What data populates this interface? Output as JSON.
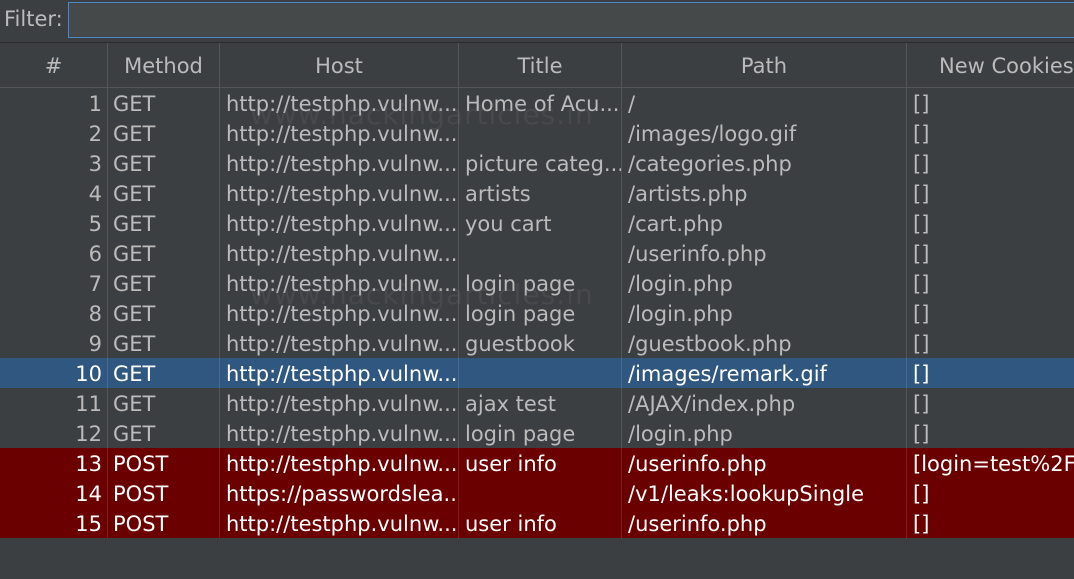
{
  "filter": {
    "label": "Filter:",
    "value": ""
  },
  "columns": [
    "#",
    "Method",
    "Host",
    "Title",
    "Path",
    "New Cookies"
  ],
  "rows": [
    {
      "num": "1",
      "method": "GET",
      "host": "http://testphp.vulnw...",
      "title": "Home of Acu...",
      "path": "/",
      "cookies": "[]",
      "state": "normal"
    },
    {
      "num": "2",
      "method": "GET",
      "host": "http://testphp.vulnw...",
      "title": "",
      "path": "/images/logo.gif",
      "cookies": "[]",
      "state": "normal"
    },
    {
      "num": "3",
      "method": "GET",
      "host": "http://testphp.vulnw...",
      "title": "picture categ...",
      "path": "/categories.php",
      "cookies": "[]",
      "state": "normal"
    },
    {
      "num": "4",
      "method": "GET",
      "host": "http://testphp.vulnw...",
      "title": "artists",
      "path": "/artists.php",
      "cookies": "[]",
      "state": "normal"
    },
    {
      "num": "5",
      "method": "GET",
      "host": "http://testphp.vulnw...",
      "title": "you cart",
      "path": "/cart.php",
      "cookies": "[]",
      "state": "normal"
    },
    {
      "num": "6",
      "method": "GET",
      "host": "http://testphp.vulnw...",
      "title": "",
      "path": "/userinfo.php",
      "cookies": "[]",
      "state": "normal"
    },
    {
      "num": "7",
      "method": "GET",
      "host": "http://testphp.vulnw...",
      "title": "login page",
      "path": "/login.php",
      "cookies": "[]",
      "state": "normal"
    },
    {
      "num": "8",
      "method": "GET",
      "host": "http://testphp.vulnw...",
      "title": "login page",
      "path": "/login.php",
      "cookies": "[]",
      "state": "normal"
    },
    {
      "num": "9",
      "method": "GET",
      "host": "http://testphp.vulnw...",
      "title": "guestbook",
      "path": "/guestbook.php",
      "cookies": "[]",
      "state": "normal"
    },
    {
      "num": "10",
      "method": "GET",
      "host": "http://testphp.vulnw...",
      "title": "",
      "path": "/images/remark.gif",
      "cookies": "[]",
      "state": "selected"
    },
    {
      "num": "11",
      "method": "GET",
      "host": "http://testphp.vulnw...",
      "title": "ajax test",
      "path": "/AJAX/index.php",
      "cookies": "[]",
      "state": "normal"
    },
    {
      "num": "12",
      "method": "GET",
      "host": "http://testphp.vulnw...",
      "title": "login page",
      "path": "/login.php",
      "cookies": "[]",
      "state": "normal"
    },
    {
      "num": "13",
      "method": "POST",
      "host": "http://testphp.vulnw...",
      "title": "user info",
      "path": "/userinfo.php",
      "cookies": "[login=test%2F",
      "state": "post"
    },
    {
      "num": "14",
      "method": "POST",
      "host": "https://passwordslea...",
      "title": "",
      "path": "/v1/leaks:lookupSingle",
      "cookies": "[]",
      "state": "post"
    },
    {
      "num": "15",
      "method": "POST",
      "host": "http://testphp.vulnw...",
      "title": "user info",
      "path": "/userinfo.php",
      "cookies": "[]",
      "state": "post"
    }
  ],
  "watermarks": [
    "www.hackingarticles.in",
    "www.hackingarticles.in"
  ],
  "colors": {
    "background": "#3c3f41",
    "selected_row": "#2f5780",
    "post_row": "#6b0000",
    "text": "#bbbbbb",
    "focus_border": "#4a88c7"
  }
}
